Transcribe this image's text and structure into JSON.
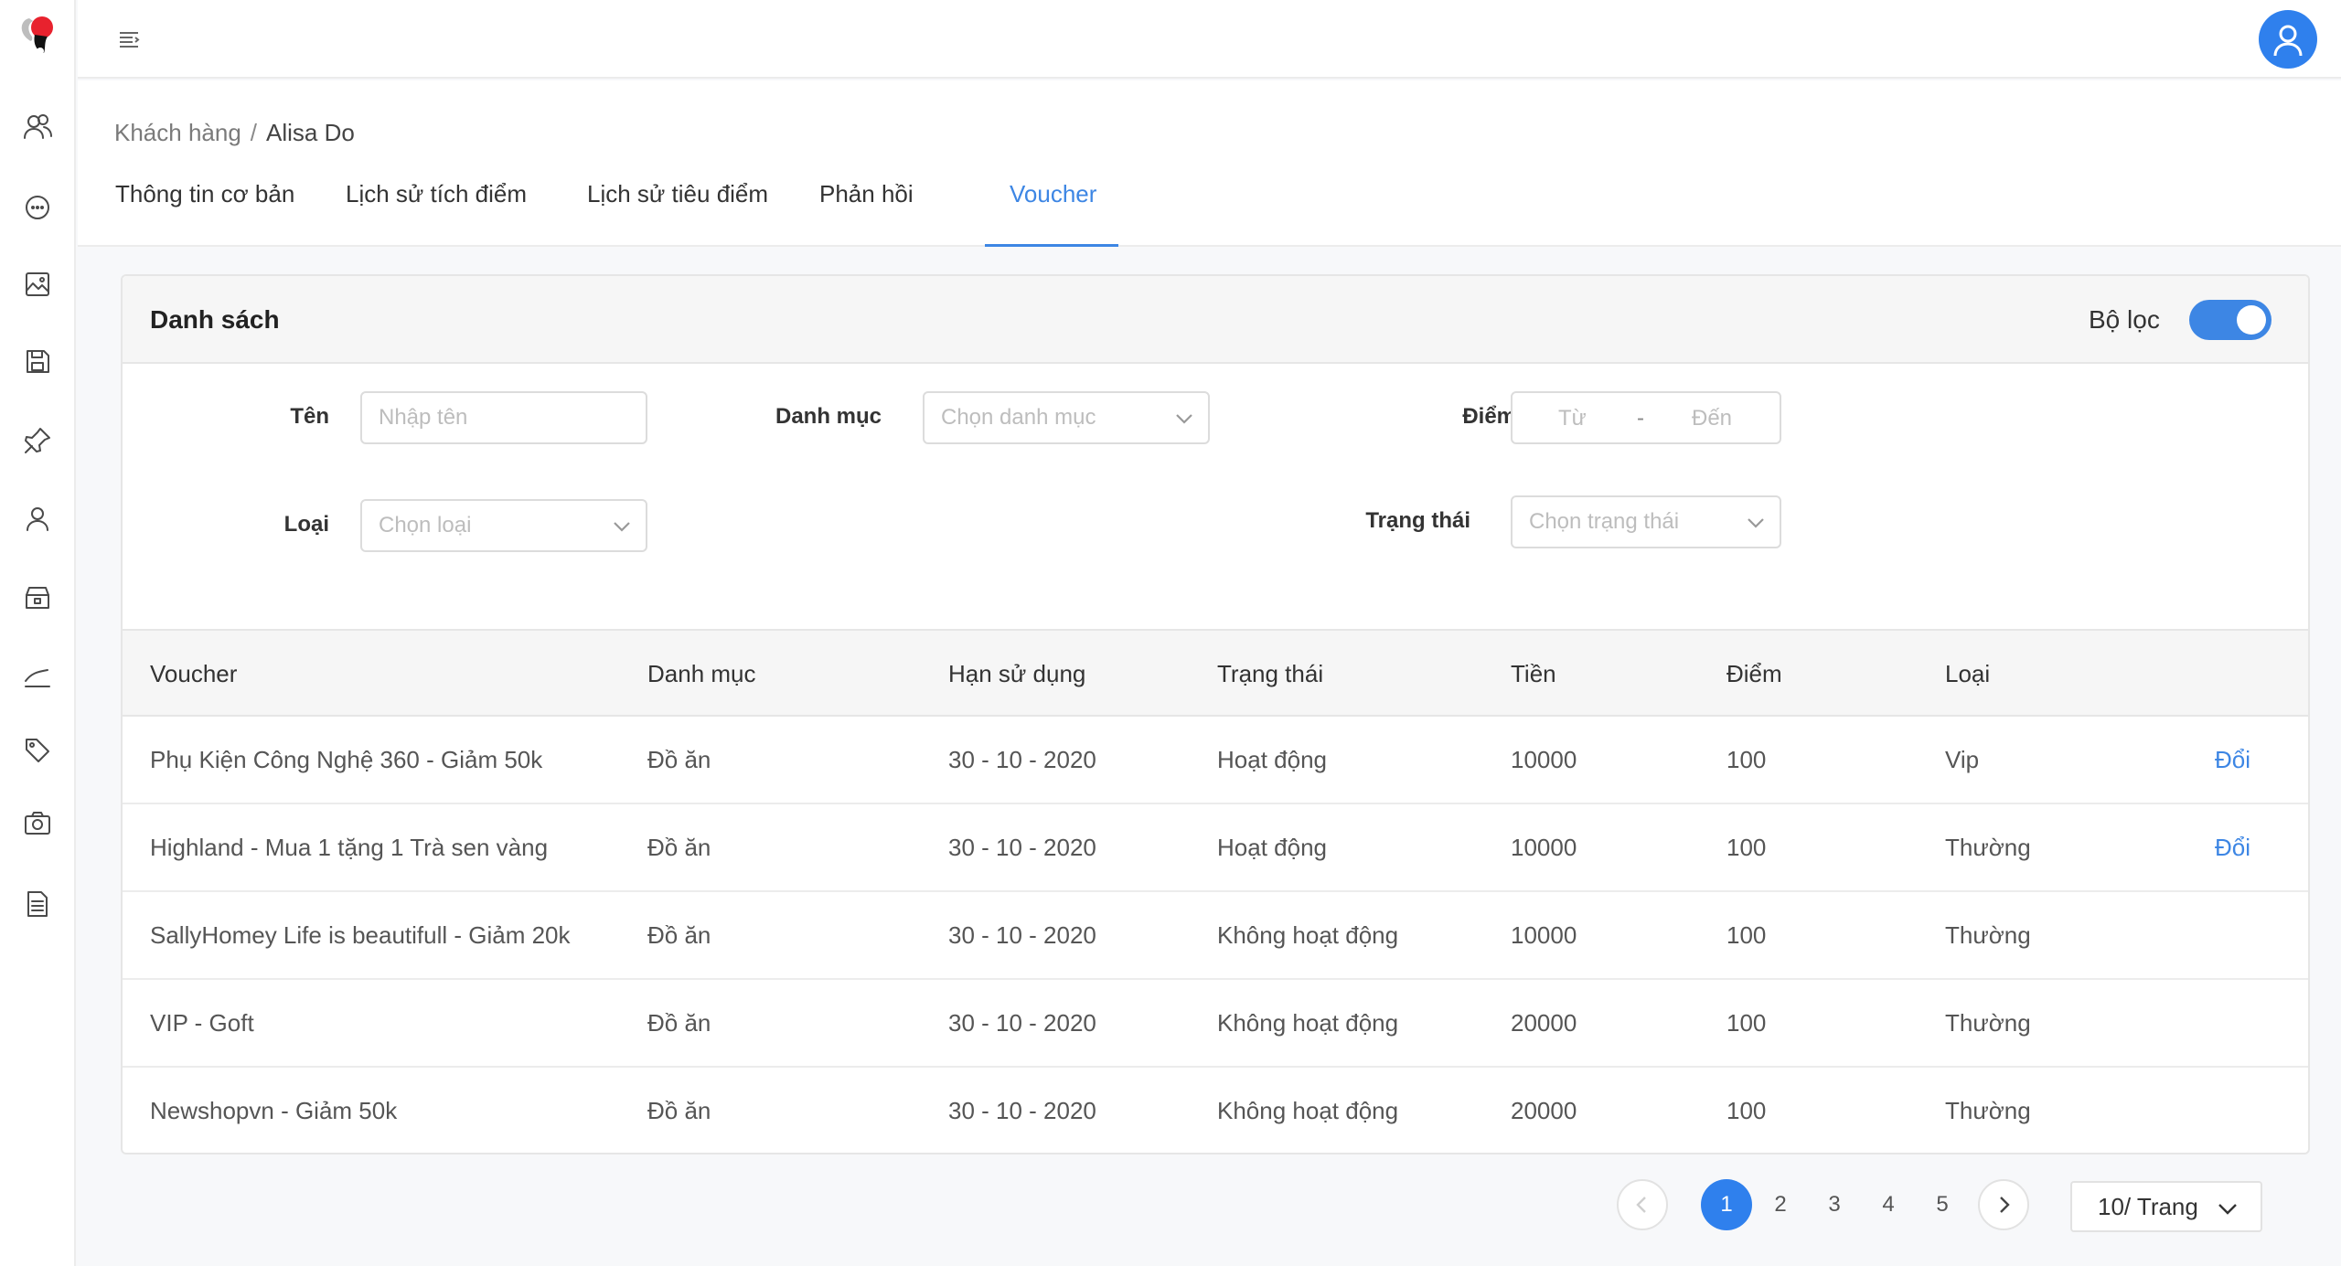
{
  "colors": {
    "accent": "#2f80ed",
    "tab_active": "#3d86e4",
    "logo_red": "#e8222e"
  },
  "sidebar": {
    "icons": [
      "users-icon",
      "chat-icon",
      "image-icon",
      "save-icon",
      "pin-icon",
      "user-icon",
      "store-icon",
      "chart-line-icon",
      "tag-icon",
      "camera-icon",
      "document-icon"
    ]
  },
  "breadcrumb": {
    "parent": "Khách hàng",
    "separator": "/",
    "current": "Alisa Do"
  },
  "tabs": [
    {
      "label": "Thông tin cơ bản"
    },
    {
      "label": "Lịch sử tích điểm"
    },
    {
      "label": "Lịch sử tiêu điểm"
    },
    {
      "label": "Phản hồi"
    },
    {
      "label": "Voucher"
    }
  ],
  "card": {
    "title": "Danh sách",
    "filter_label": "Bộ lọc",
    "filter_on": true
  },
  "filters": {
    "name": {
      "label": "Tên",
      "placeholder": "Nhập tên"
    },
    "category": {
      "label": "Danh mục",
      "placeholder": "Chọn danh mục"
    },
    "points": {
      "label": "Điểm",
      "from": "Từ",
      "dash": "-",
      "to": "Đến"
    },
    "type": {
      "label": "Loại",
      "placeholder": "Chọn loại"
    },
    "status": {
      "label": "Trạng thái",
      "placeholder": "Chọn trạng thái"
    }
  },
  "table": {
    "columns": [
      "Voucher",
      "Danh mục",
      "Hạn sử dụng",
      "Trạng thái",
      "Tiền",
      "Điểm",
      "Loại"
    ],
    "rows": [
      {
        "voucher": "Phụ Kiện Công Nghệ 360 - Giảm 50k",
        "category": "Đồ ăn",
        "expiry": "30 - 10 - 2020",
        "status": "Hoạt động",
        "money": "10000",
        "points": "100",
        "type": "Vip",
        "action": "Đổi"
      },
      {
        "voucher": "Highland - Mua 1 tặng 1 Trà sen vàng",
        "category": "Đồ ăn",
        "expiry": "30 - 10 - 2020",
        "status": "Hoạt động",
        "money": "10000",
        "points": "100",
        "type": "Thường",
        "action": "Đổi"
      },
      {
        "voucher": "SallyHomey Life is beautifull - Giảm 20k",
        "category": "Đồ ăn",
        "expiry": "30 - 10 - 2020",
        "status": "Không hoạt động",
        "money": "10000",
        "points": "100",
        "type": "Thường",
        "action": ""
      },
      {
        "voucher": "VIP - Goft",
        "category": "Đồ ăn",
        "expiry": "30 - 10 - 2020",
        "status": "Không hoạt động",
        "money": "20000",
        "points": "100",
        "type": "Thường",
        "action": ""
      },
      {
        "voucher": "Newshopvn - Giảm 50k",
        "category": "Đồ ăn",
        "expiry": "30 - 10 - 2020",
        "status": "Không hoạt động",
        "money": "20000",
        "points": "100",
        "type": "Thường",
        "action": ""
      }
    ]
  },
  "pagination": {
    "pages": [
      "1",
      "2",
      "3",
      "4",
      "5"
    ],
    "current": "1",
    "page_size": "10/ Trang"
  }
}
